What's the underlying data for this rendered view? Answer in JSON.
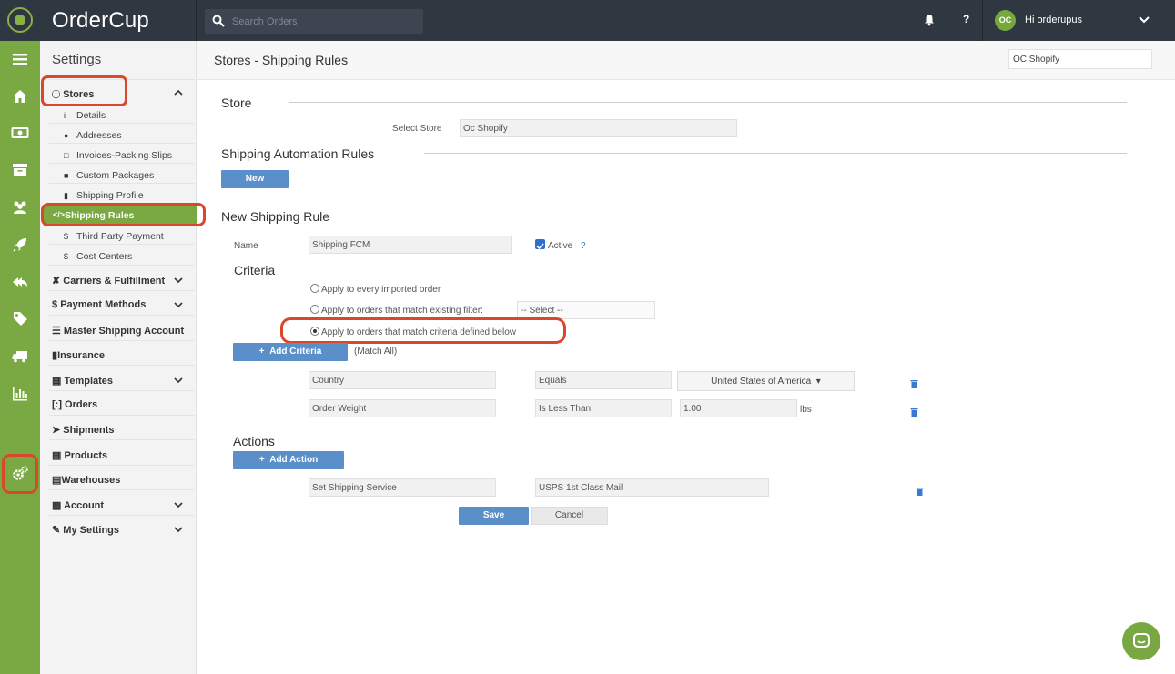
{
  "header": {
    "brand": "OrderCup",
    "search_placeholder": "Search Orders",
    "help_label": "?",
    "avatar_initials": "OC",
    "greeting": "Hi orderupus"
  },
  "sidebar": {
    "title": "Settings",
    "stores_label": "Stores",
    "store_items": [
      {
        "label": "Details"
      },
      {
        "label": "Addresses"
      },
      {
        "label": "Invoices-Packing Slips"
      },
      {
        "label": "Custom Packages"
      },
      {
        "label": "Shipping Profile"
      },
      {
        "label": "Shipping Rules"
      },
      {
        "label": "Third Party Payment"
      },
      {
        "label": "Cost Centers"
      }
    ],
    "sections": [
      {
        "label": "Carriers & Fulfillment"
      },
      {
        "label": "Payment Methods"
      },
      {
        "label": "Master Shipping Account"
      },
      {
        "label": "Insurance"
      },
      {
        "label": "Templates"
      },
      {
        "label": "Orders"
      },
      {
        "label": "Shipments"
      },
      {
        "label": "Products"
      },
      {
        "label": "Warehouses"
      },
      {
        "label": "Account"
      },
      {
        "label": "My Settings"
      }
    ]
  },
  "page": {
    "title": "Stores - Shipping Rules",
    "store_selector_value": "OC Shopify"
  },
  "store_section": {
    "title": "Store",
    "select_label": "Select Store",
    "select_value": "Oc Shopify"
  },
  "automation": {
    "title": "Shipping Automation Rules",
    "new_button": "New"
  },
  "new_rule": {
    "title": "New Shipping Rule",
    "name_label": "Name",
    "name_value": "Shipping FCM",
    "active_label": "Active",
    "active_help": "?",
    "criteria_title": "Criteria",
    "radio_options": [
      {
        "label": "Apply to every imported order",
        "selected": false
      },
      {
        "label": "Apply to orders that match existing filter:",
        "selected": false
      },
      {
        "label": "Apply to orders that match criteria defined below",
        "selected": true
      }
    ],
    "filter_placeholder": "-- Select --",
    "add_criteria_button": "Add Criteria",
    "match_label": "(Match All)",
    "criteria_rows": [
      {
        "field": "Country",
        "operator": "Equals",
        "value": "United States of America"
      },
      {
        "field": "Order Weight",
        "operator": "Is Less Than",
        "value": "1.00",
        "unit": "lbs"
      }
    ],
    "actions_title": "Actions",
    "add_action_button": "Add Action",
    "action_rows": [
      {
        "action": "Set Shipping Service",
        "value": "USPS 1st Class Mail"
      }
    ],
    "save_button": "Save",
    "cancel_button": "Cancel"
  },
  "colors": {
    "accent_green": "#7aa842",
    "topbar": "#2f3740",
    "button_blue": "#5a8fc9",
    "highlight_red": "#d9482b"
  }
}
